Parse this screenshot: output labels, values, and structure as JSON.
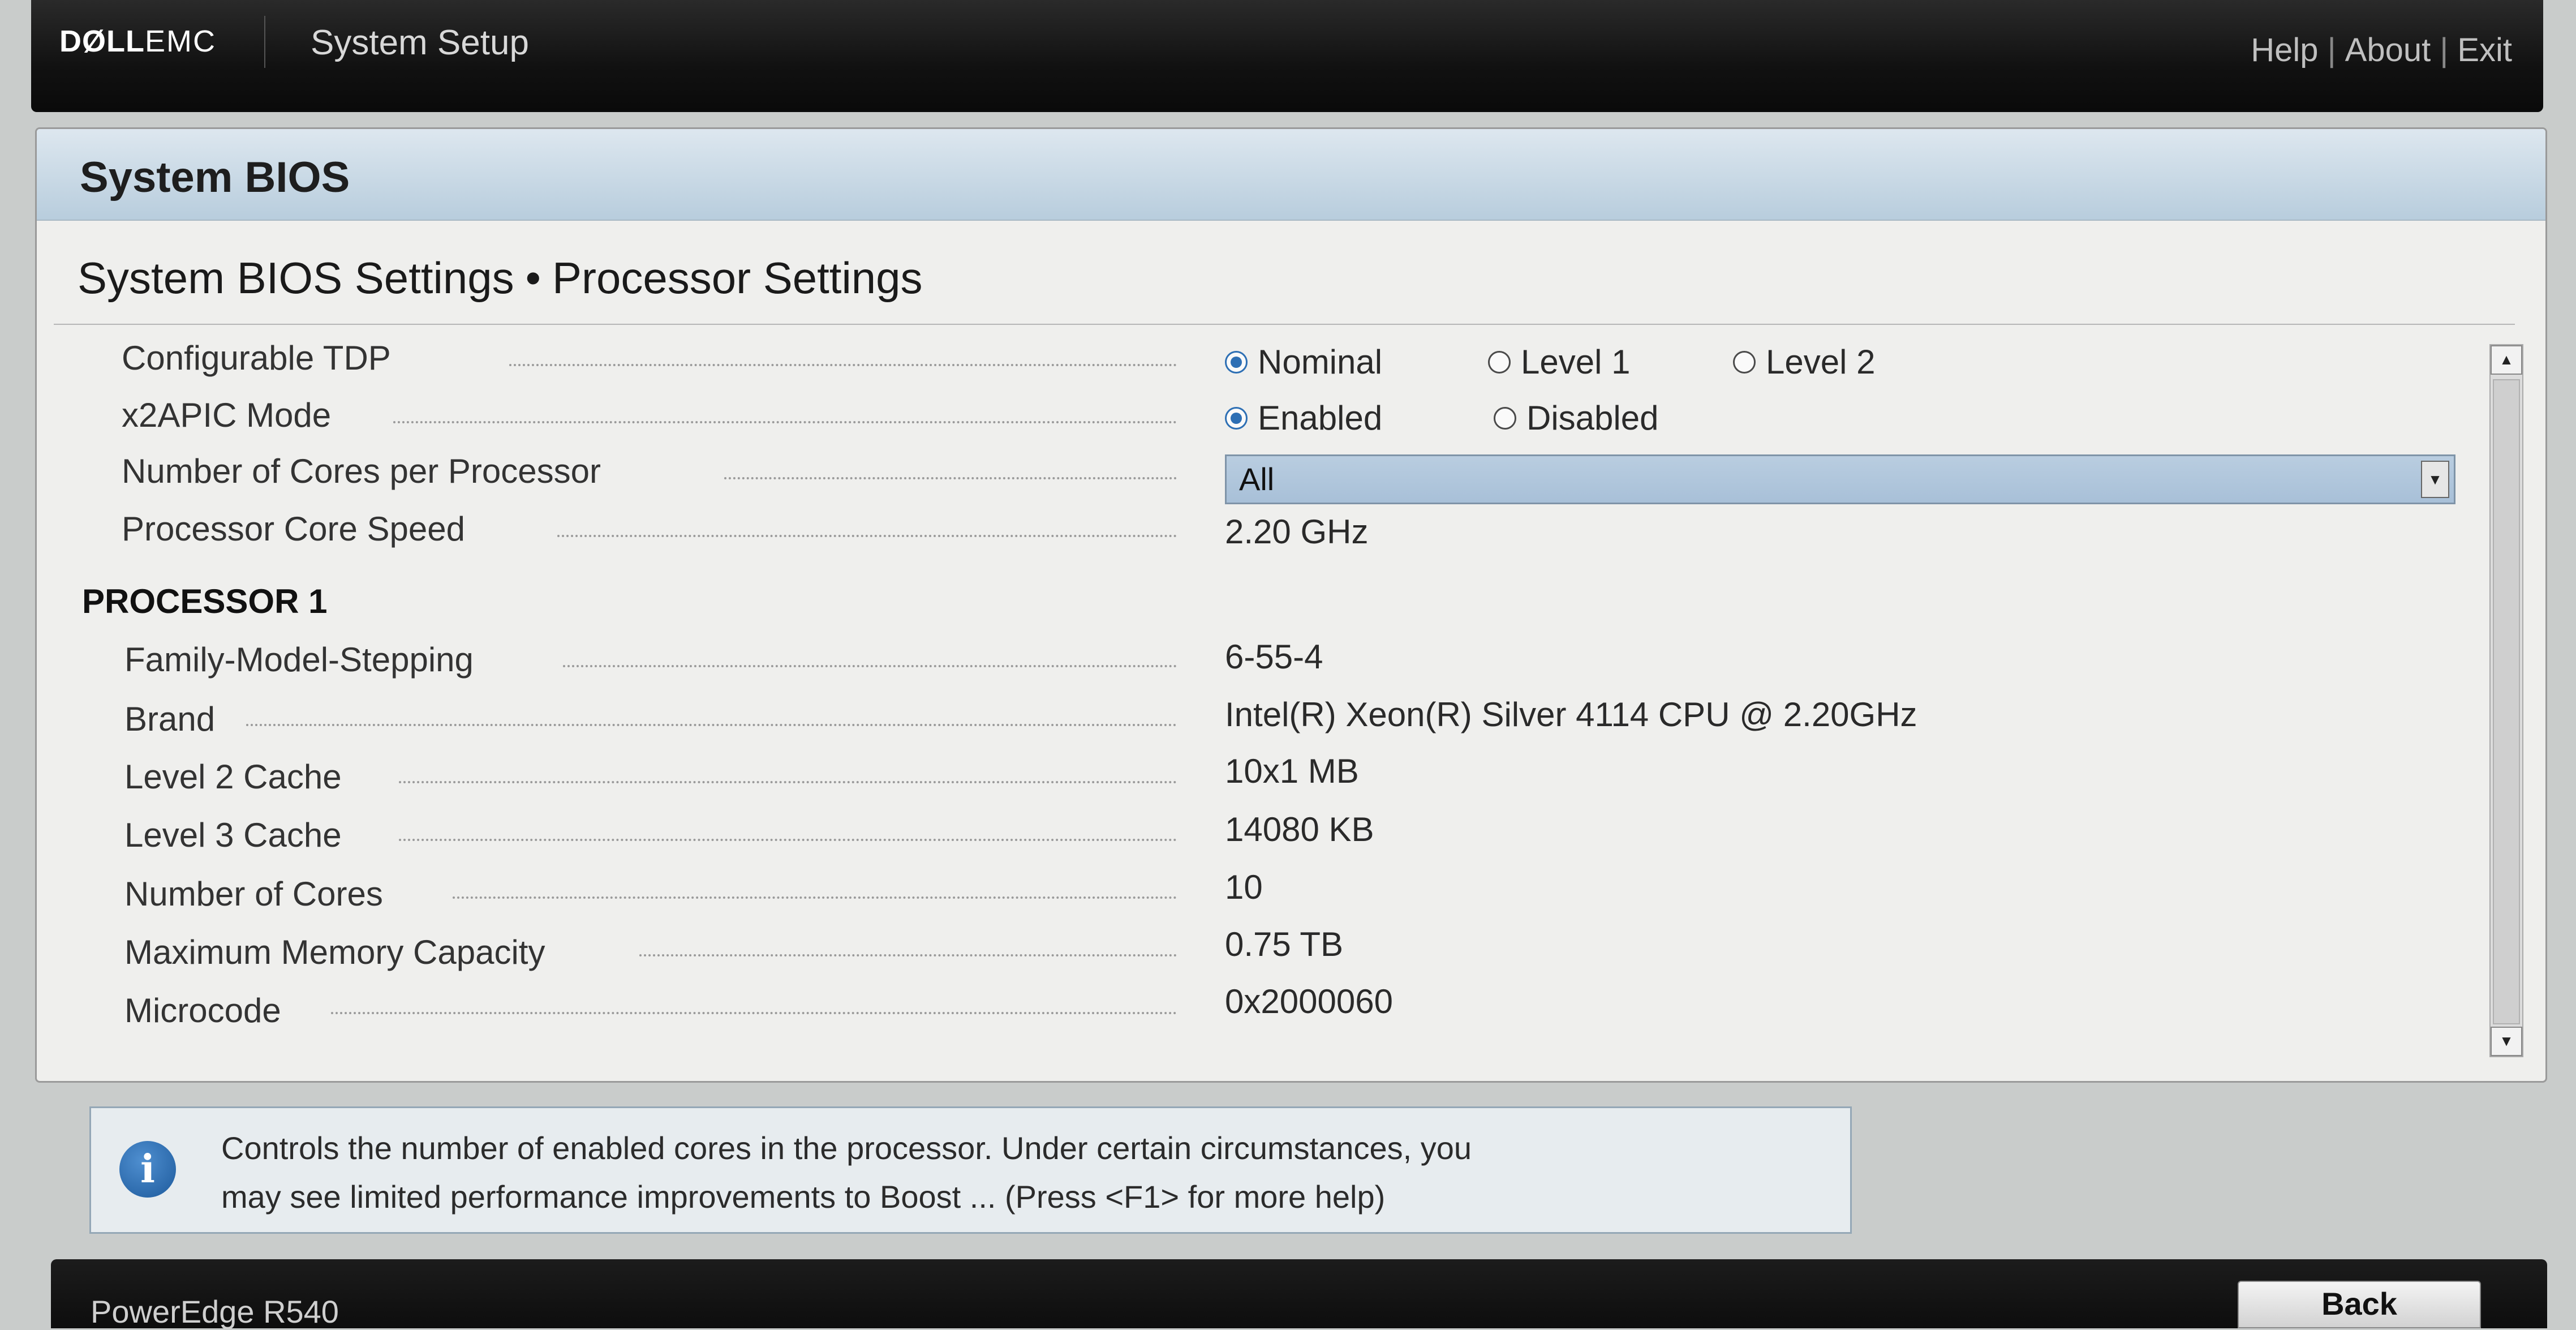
{
  "header": {
    "logo_dell": "DØLL",
    "logo_emc": "EMC",
    "app_title": "System Setup",
    "links": {
      "help": "Help",
      "about": "About",
      "exit": "Exit",
      "separator": "|"
    }
  },
  "panel": {
    "title": "System BIOS",
    "breadcrumb_parent": "System BIOS Settings",
    "breadcrumb_separator": "•",
    "breadcrumb_current": "Processor Settings"
  },
  "settings": {
    "configurable_tdp": {
      "label": "Configurable TDP",
      "options": [
        "Nominal",
        "Level 1",
        "Level 2"
      ],
      "selected": "Nominal"
    },
    "x2apic_mode": {
      "label": "x2APIC Mode",
      "options": [
        "Enabled",
        "Disabled"
      ],
      "selected": "Enabled"
    },
    "cores_per_processor": {
      "label": "Number of Cores per Processor",
      "value": "All"
    },
    "core_speed": {
      "label": "Processor Core Speed",
      "value": "2.20 GHz"
    }
  },
  "processor1": {
    "heading": "PROCESSOR 1",
    "rows": [
      {
        "label": "Family-Model-Stepping",
        "value": "6-55-4"
      },
      {
        "label": "Brand",
        "value": "Intel(R) Xeon(R) Silver 4114 CPU @ 2.20GHz"
      },
      {
        "label": "Level 2 Cache",
        "value": "10x1 MB"
      },
      {
        "label": "Level 3 Cache",
        "value": "14080 KB"
      },
      {
        "label": "Number of Cores",
        "value": "10"
      },
      {
        "label": "Maximum Memory Capacity",
        "value": "0.75 TB"
      },
      {
        "label": "Microcode",
        "value": "0x2000060"
      }
    ]
  },
  "help": {
    "line1": "Controls the number of enabled cores in the processor. Under certain circumstances, you",
    "line2": "may see limited performance improvements to Boost ... (Press <F1> for more help)"
  },
  "footer": {
    "model": "PowerEdge R540",
    "back_label": "Back"
  },
  "colors": {
    "selected_field": "#a8c0d8",
    "header_gradient_top": "#dde7ef",
    "radio_selected": "#2d6fb4"
  }
}
